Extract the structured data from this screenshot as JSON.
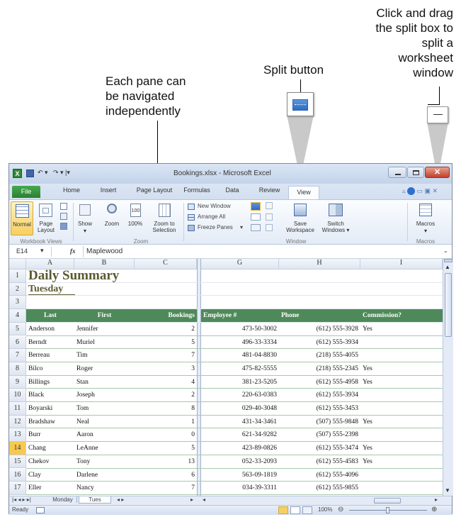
{
  "callouts": {
    "split_box": "Click and drag the split box to split a worksheet window",
    "split_box_lines": [
      "Click and drag",
      "the split box to",
      "split a",
      "worksheet",
      "window"
    ],
    "split_button": "Split button",
    "panes_lines": [
      "Each pane can",
      "be navigated",
      "independently"
    ]
  },
  "window": {
    "title": "Bookings.xlsx - Microsoft Excel",
    "tabs": [
      "File",
      "Home",
      "Insert",
      "Page Layout",
      "Formulas",
      "Data",
      "Review",
      "View"
    ],
    "active_tab": "View",
    "ribbon": {
      "normal": "Normal",
      "page_layout": "Page Layout",
      "show": "Show",
      "zoom": "Zoom",
      "zoom100": "100%",
      "zoom_to_selection": "Zoom to Selection",
      "new_window": "New Window",
      "arrange_all": "Arrange All",
      "freeze_panes": "Freeze Panes",
      "save_workspace": "Save Workspace",
      "switch_windows": "Switch Windows",
      "macros": "Macros",
      "group_workbook_views": "Workbook Views",
      "group_zoom": "Zoom",
      "group_window": "Window",
      "group_macros": "Macros"
    },
    "name_box": "E14",
    "fx": "fx",
    "formula_value": "Maplewood",
    "columns_left": [
      "A",
      "B",
      "C"
    ],
    "columns_right": [
      "G",
      "H",
      "I"
    ],
    "rows": [
      {
        "n": "1",
        "a": "Daily Summary",
        "b": "",
        "c": "",
        "g": "",
        "h": "",
        "i": ""
      },
      {
        "n": "2",
        "a": "Tuesday",
        "b": "",
        "c": "",
        "g": "",
        "h": "",
        "i": ""
      },
      {
        "n": "3",
        "a": "",
        "b": "",
        "c": "",
        "g": "",
        "h": "",
        "i": ""
      },
      {
        "n": "4",
        "a": "Last",
        "b": "First",
        "c": "Bookings",
        "g": "Employee #",
        "h": "Phone",
        "i": "Commission?"
      },
      {
        "n": "5",
        "a": "Anderson",
        "b": "Jennifer",
        "c": "2",
        "g": "473-50-3002",
        "h": "(612) 555-3928",
        "i": "Yes"
      },
      {
        "n": "6",
        "a": "Berndt",
        "b": "Muriel",
        "c": "5",
        "g": "496-33-3334",
        "h": "(612) 555-3934",
        "i": ""
      },
      {
        "n": "7",
        "a": "Berreau",
        "b": "Tim",
        "c": "7",
        "g": "481-04-8830",
        "h": "(218) 555-4055",
        "i": ""
      },
      {
        "n": "8",
        "a": "Bilco",
        "b": "Roger",
        "c": "3",
        "g": "475-82-5555",
        "h": "(218) 555-2345",
        "i": "Yes"
      },
      {
        "n": "9",
        "a": "Billings",
        "b": "Stan",
        "c": "4",
        "g": "381-23-5205",
        "h": "(612) 555-4958",
        "i": "Yes"
      },
      {
        "n": "10",
        "a": "Black",
        "b": "Joseph",
        "c": "2",
        "g": "220-63-0383",
        "h": "(612) 555-3934",
        "i": ""
      },
      {
        "n": "11",
        "a": "Boyarski",
        "b": "Tom",
        "c": "8",
        "g": "029-40-3048",
        "h": "(612) 555-3453",
        "i": ""
      },
      {
        "n": "12",
        "a": "Bradshaw",
        "b": "Neal",
        "c": "1",
        "g": "431-34-3461",
        "h": "(507) 555-9848",
        "i": "Yes"
      },
      {
        "n": "13",
        "a": "Burr",
        "b": "Aaron",
        "c": "0",
        "g": "621-34-9282",
        "h": "(507) 555-2398",
        "i": ""
      },
      {
        "n": "14",
        "a": "Chang",
        "b": "LeAnne",
        "c": "5",
        "g": "423-89-0826",
        "h": "(612) 555-3474",
        "i": "Yes"
      },
      {
        "n": "15",
        "a": "Chekov",
        "b": "Tony",
        "c": "13",
        "g": "052-33-2093",
        "h": "(612) 555-4583",
        "i": "Yes"
      },
      {
        "n": "16",
        "a": "Clay",
        "b": "Darlene",
        "c": "6",
        "g": "563-09-1819",
        "h": "(612) 555-4096",
        "i": ""
      },
      {
        "n": "17",
        "a": "Eller",
        "b": "Nancy",
        "c": "7",
        "g": "034-39-3311",
        "h": "(612) 555-9855",
        "i": ""
      }
    ],
    "sheet_tabs": [
      "Monday",
      "Tues"
    ],
    "status": "Ready",
    "zoom_level": "100%",
    "colors": {
      "header_green": "#4e8a59",
      "title_text": "#5a5a30",
      "file_tab": "#2f8a36",
      "active_row": "#f6c94f"
    }
  }
}
